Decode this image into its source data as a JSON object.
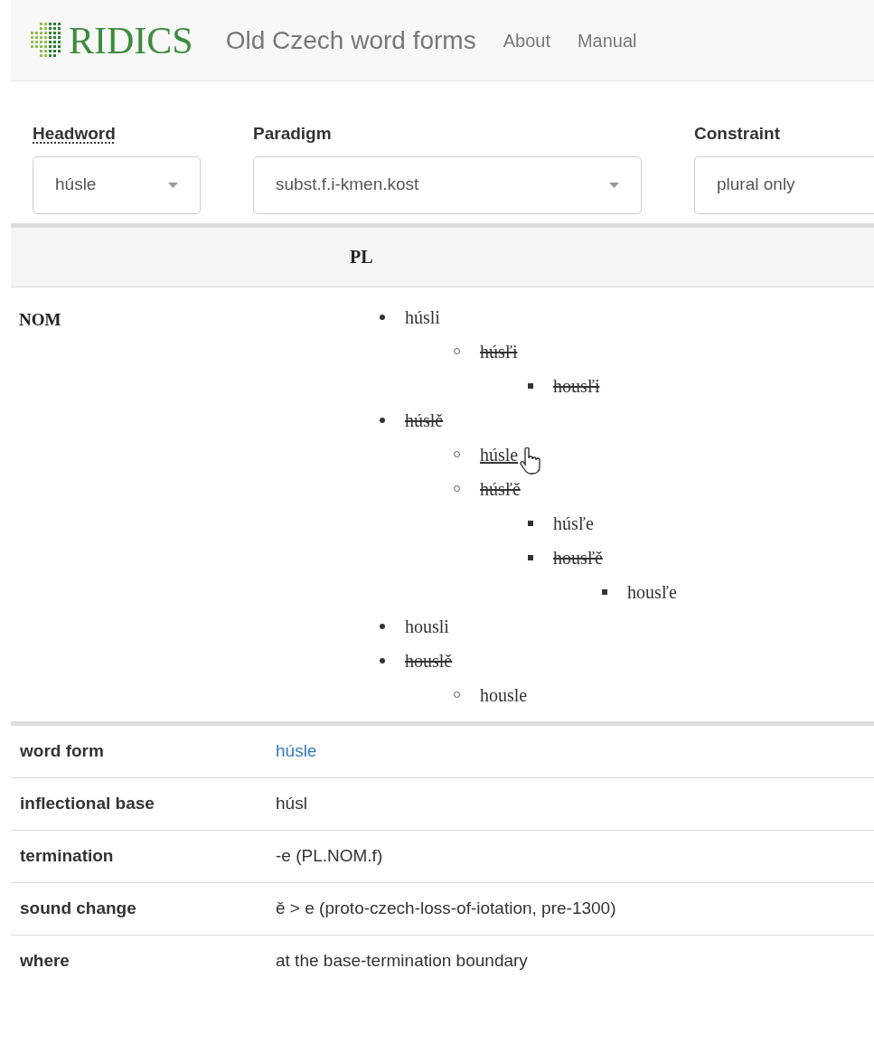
{
  "navbar": {
    "brand": "RIDICS",
    "title": "Old Czech word forms",
    "links": [
      "About",
      "Manual"
    ]
  },
  "filters": [
    {
      "label": "Headword",
      "abbr": true,
      "value": "húsle",
      "kind": "dropdown"
    },
    {
      "label": "Paradigm",
      "abbr": false,
      "value": "subst.f.i-kmen.kost",
      "kind": "dropdown"
    },
    {
      "label": "Constraint",
      "abbr": false,
      "value": "plural only",
      "kind": "text"
    }
  ],
  "paradigm_table": {
    "columns": [
      "PL"
    ],
    "rows": [
      {
        "case": "NOM",
        "forms": [
          {
            "form": "húsli",
            "struck": false,
            "hovered": false,
            "children": [
              {
                "form": "húsľi",
                "struck": true,
                "hovered": false,
                "children": [
                  {
                    "form": "housľi",
                    "struck": true,
                    "hovered": false
                  }
                ]
              }
            ]
          },
          {
            "form": "húslě",
            "struck": true,
            "hovered": false,
            "children": [
              {
                "form": "húsle",
                "struck": false,
                "hovered": true
              },
              {
                "form": "húsľě",
                "struck": true,
                "hovered": false,
                "children": [
                  {
                    "form": "húsľe",
                    "struck": false,
                    "hovered": false
                  },
                  {
                    "form": "housľě",
                    "struck": true,
                    "hovered": false,
                    "children": [
                      {
                        "form": "housľe",
                        "struck": false,
                        "hovered": false
                      }
                    ]
                  }
                ]
              }
            ]
          },
          {
            "form": "housli",
            "struck": false,
            "hovered": false
          },
          {
            "form": "houslě",
            "struck": true,
            "hovered": false,
            "children": [
              {
                "form": "housle",
                "struck": false,
                "hovered": false
              }
            ]
          }
        ]
      }
    ]
  },
  "details": [
    {
      "label": "word form",
      "value": "húsle",
      "link": true
    },
    {
      "label": "inflectional base",
      "value": "húsl",
      "link": false
    },
    {
      "label": "termination",
      "value": "-e (PL.NOM.f)",
      "link": false
    },
    {
      "label": "sound change",
      "value": "ě > e (proto-czech-loss-of-iotation, pre-1300)",
      "link": false
    },
    {
      "label": "where",
      "value": "at the base-termination boundary",
      "link": false
    }
  ]
}
